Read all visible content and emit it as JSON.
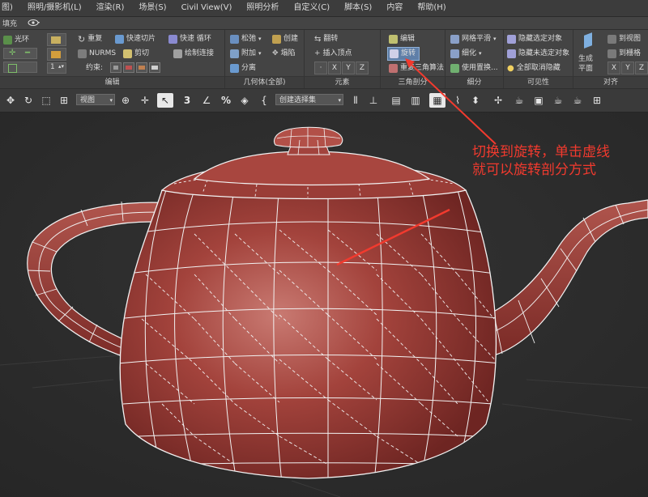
{
  "menubar": {
    "items": [
      "图)",
      "照明/摄影机(L)",
      "渲染(R)",
      "场景(S)",
      "Civil View(V)",
      "照明分析",
      "自定义(C)",
      "脚本(S)",
      "内容",
      "帮助(H)"
    ]
  },
  "tabrow": {
    "tab_label": "填充"
  },
  "ribbon": {
    "edit_group": {
      "label": "编辑",
      "ring": "光环",
      "repeat": "重复",
      "quickslice": "快速切片",
      "quickloop": "快速 循环",
      "nurms": "NURMS",
      "cut": "剪切",
      "paintconnect": "绘制连接",
      "constraint_label": "约束:",
      "spinner_value": "1"
    },
    "geometry_group": {
      "label": "几何体(全部)",
      "relax": "松弛",
      "create": "创建",
      "attach": "附加",
      "collapse": "塌陷",
      "detach": "分离"
    },
    "elements_group": {
      "label": "元素",
      "flip": "翻转",
      "insert_vertex": "插入顶点",
      "x": "X",
      "y": "Y",
      "z": "Z"
    },
    "triangulation_group": {
      "label": "三角剖分",
      "edit": "编辑",
      "rotate": "旋转",
      "retriangulate": "重复三角算法"
    },
    "subdivision_group": {
      "label": "细分",
      "meshsmooth": "网格平滑",
      "tessellate": "细化",
      "use_displacement": "使用置换..."
    },
    "visibility_group": {
      "label": "可见性",
      "hide_selected": "隐藏选定对象",
      "hide_unselected": "隐藏未选定对象",
      "unhide_all": "全部取消隐藏"
    },
    "align_group": {
      "label": "对齐",
      "make_planar": "生成",
      "make_planar2": "平面",
      "to_view": "到视图",
      "to_grid": "到栅格",
      "x": "X",
      "y": "Y",
      "z": "Z"
    }
  },
  "toolbar": {
    "view_dropdown": "视图",
    "selection_set_placeholder": "创建选择集",
    "snap_label": "3",
    "angle_snap_label": "∠",
    "percent_snap_label": "%"
  },
  "annotation": {
    "line1": "切换到旋转，单击虚线",
    "line2": "就可以旋转剖分方式",
    "color": "#f23a2e"
  },
  "colors": {
    "teapot_base": "#a3433c",
    "teapot_highlight": "#c97a72",
    "wire": "#ffffff"
  }
}
